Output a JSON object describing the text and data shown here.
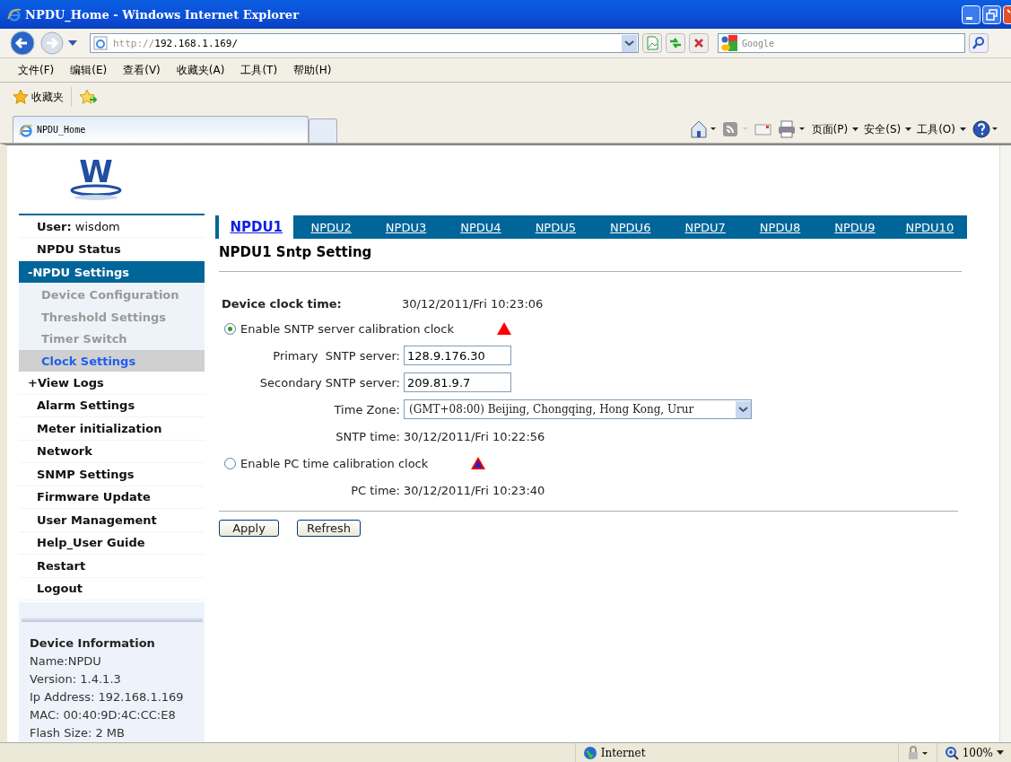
{
  "browser": {
    "title": "NPDU_Home - Windows Internet Explorer",
    "address_scheme": "http://",
    "address_host": "192.168.1.169/",
    "search_placeholder": "Google",
    "menu": [
      "文件(F)",
      "编辑(E)",
      "查看(V)",
      "收藏夹(A)",
      "工具(T)",
      "帮助(H)"
    ],
    "favorites": "收藏夹",
    "tab": "NPDU_Home",
    "commands": [
      "页面(P)",
      "安全(S)",
      "工具(O)"
    ],
    "status_zone": "Internet",
    "zoom": "100%"
  },
  "logo": {
    "letter": "W"
  },
  "sidebar": {
    "user_label": "User:",
    "user_name": "wisdom",
    "items": [
      {
        "label": "NPDU Status",
        "kind": "item",
        "selected": false
      },
      {
        "label": "-NPDU Settings",
        "kind": "group",
        "expanded": true
      },
      {
        "label": "Device Configuration",
        "kind": "sub",
        "selected": false
      },
      {
        "label": "Threshold Settings",
        "kind": "sub",
        "selected": false
      },
      {
        "label": "Timer Switch",
        "kind": "sub",
        "selected": false
      },
      {
        "label": "Clock Settings",
        "kind": "sub",
        "selected": true
      },
      {
        "label": "+View Logs",
        "kind": "group",
        "expanded": false
      },
      {
        "label": "Alarm Settings",
        "kind": "item",
        "selected": false
      },
      {
        "label": "Meter initialization",
        "kind": "item",
        "selected": false
      },
      {
        "label": "Network",
        "kind": "item",
        "selected": false
      },
      {
        "label": "SNMP Settings",
        "kind": "item",
        "selected": false
      },
      {
        "label": "Firmware Update",
        "kind": "item",
        "selected": false
      },
      {
        "label": "User Management",
        "kind": "item",
        "selected": false
      },
      {
        "label": "Help_User Guide",
        "kind": "item",
        "selected": false
      },
      {
        "label": "Restart",
        "kind": "item",
        "selected": false
      },
      {
        "label": "Logout",
        "kind": "item",
        "selected": false
      }
    ],
    "device_info": {
      "title": "Device Information",
      "lines": [
        "Name:NPDU",
        "Version: 1.4.1.3",
        "Ip Address: 192.168.1.169",
        "MAC: 00:40:9D:4C:CC:E8",
        "Flash Size: 2 MB"
      ]
    }
  },
  "tabs": [
    {
      "label": "NPDU1",
      "selected": true
    },
    {
      "label": "NPDU2",
      "selected": false
    },
    {
      "label": "NPDU3",
      "selected": false
    },
    {
      "label": "NPDU4",
      "selected": false
    },
    {
      "label": "NPDU5",
      "selected": false
    },
    {
      "label": "NPDU6",
      "selected": false
    },
    {
      "label": "NPDU7",
      "selected": false
    },
    {
      "label": "NPDU8",
      "selected": false
    },
    {
      "label": "NPDU9",
      "selected": false
    },
    {
      "label": "NPDU10",
      "selected": false
    }
  ],
  "page": {
    "heading": "NPDU1 Sntp Setting",
    "clock_label": "Device clock time:",
    "clock_value": "30/12/2011/Fri 10:23:06",
    "sntp": {
      "label": "Enable SNTP server calibration clock",
      "selected": true,
      "fields": [
        {
          "kind": "input",
          "label": "Primary  SNTP server:",
          "value": "128.9.176.30"
        },
        {
          "kind": "input",
          "label": "Secondary SNTP server:",
          "value": "209.81.9.7"
        },
        {
          "kind": "select",
          "label": "Time Zone:",
          "value": "(GMT+08:00) Beijing, Chongqing, Hong Kong, Urur"
        },
        {
          "kind": "text",
          "label": "SNTP time:",
          "value": "30/12/2011/Fri 10:22:56"
        }
      ]
    },
    "pc": {
      "label": "Enable PC time calibration clock",
      "selected": false,
      "fields": [
        {
          "kind": "text",
          "label": "PC time:",
          "value": "30/12/2011/Fri 10:23:40"
        }
      ]
    },
    "buttons": [
      "Apply",
      "Refresh"
    ]
  }
}
